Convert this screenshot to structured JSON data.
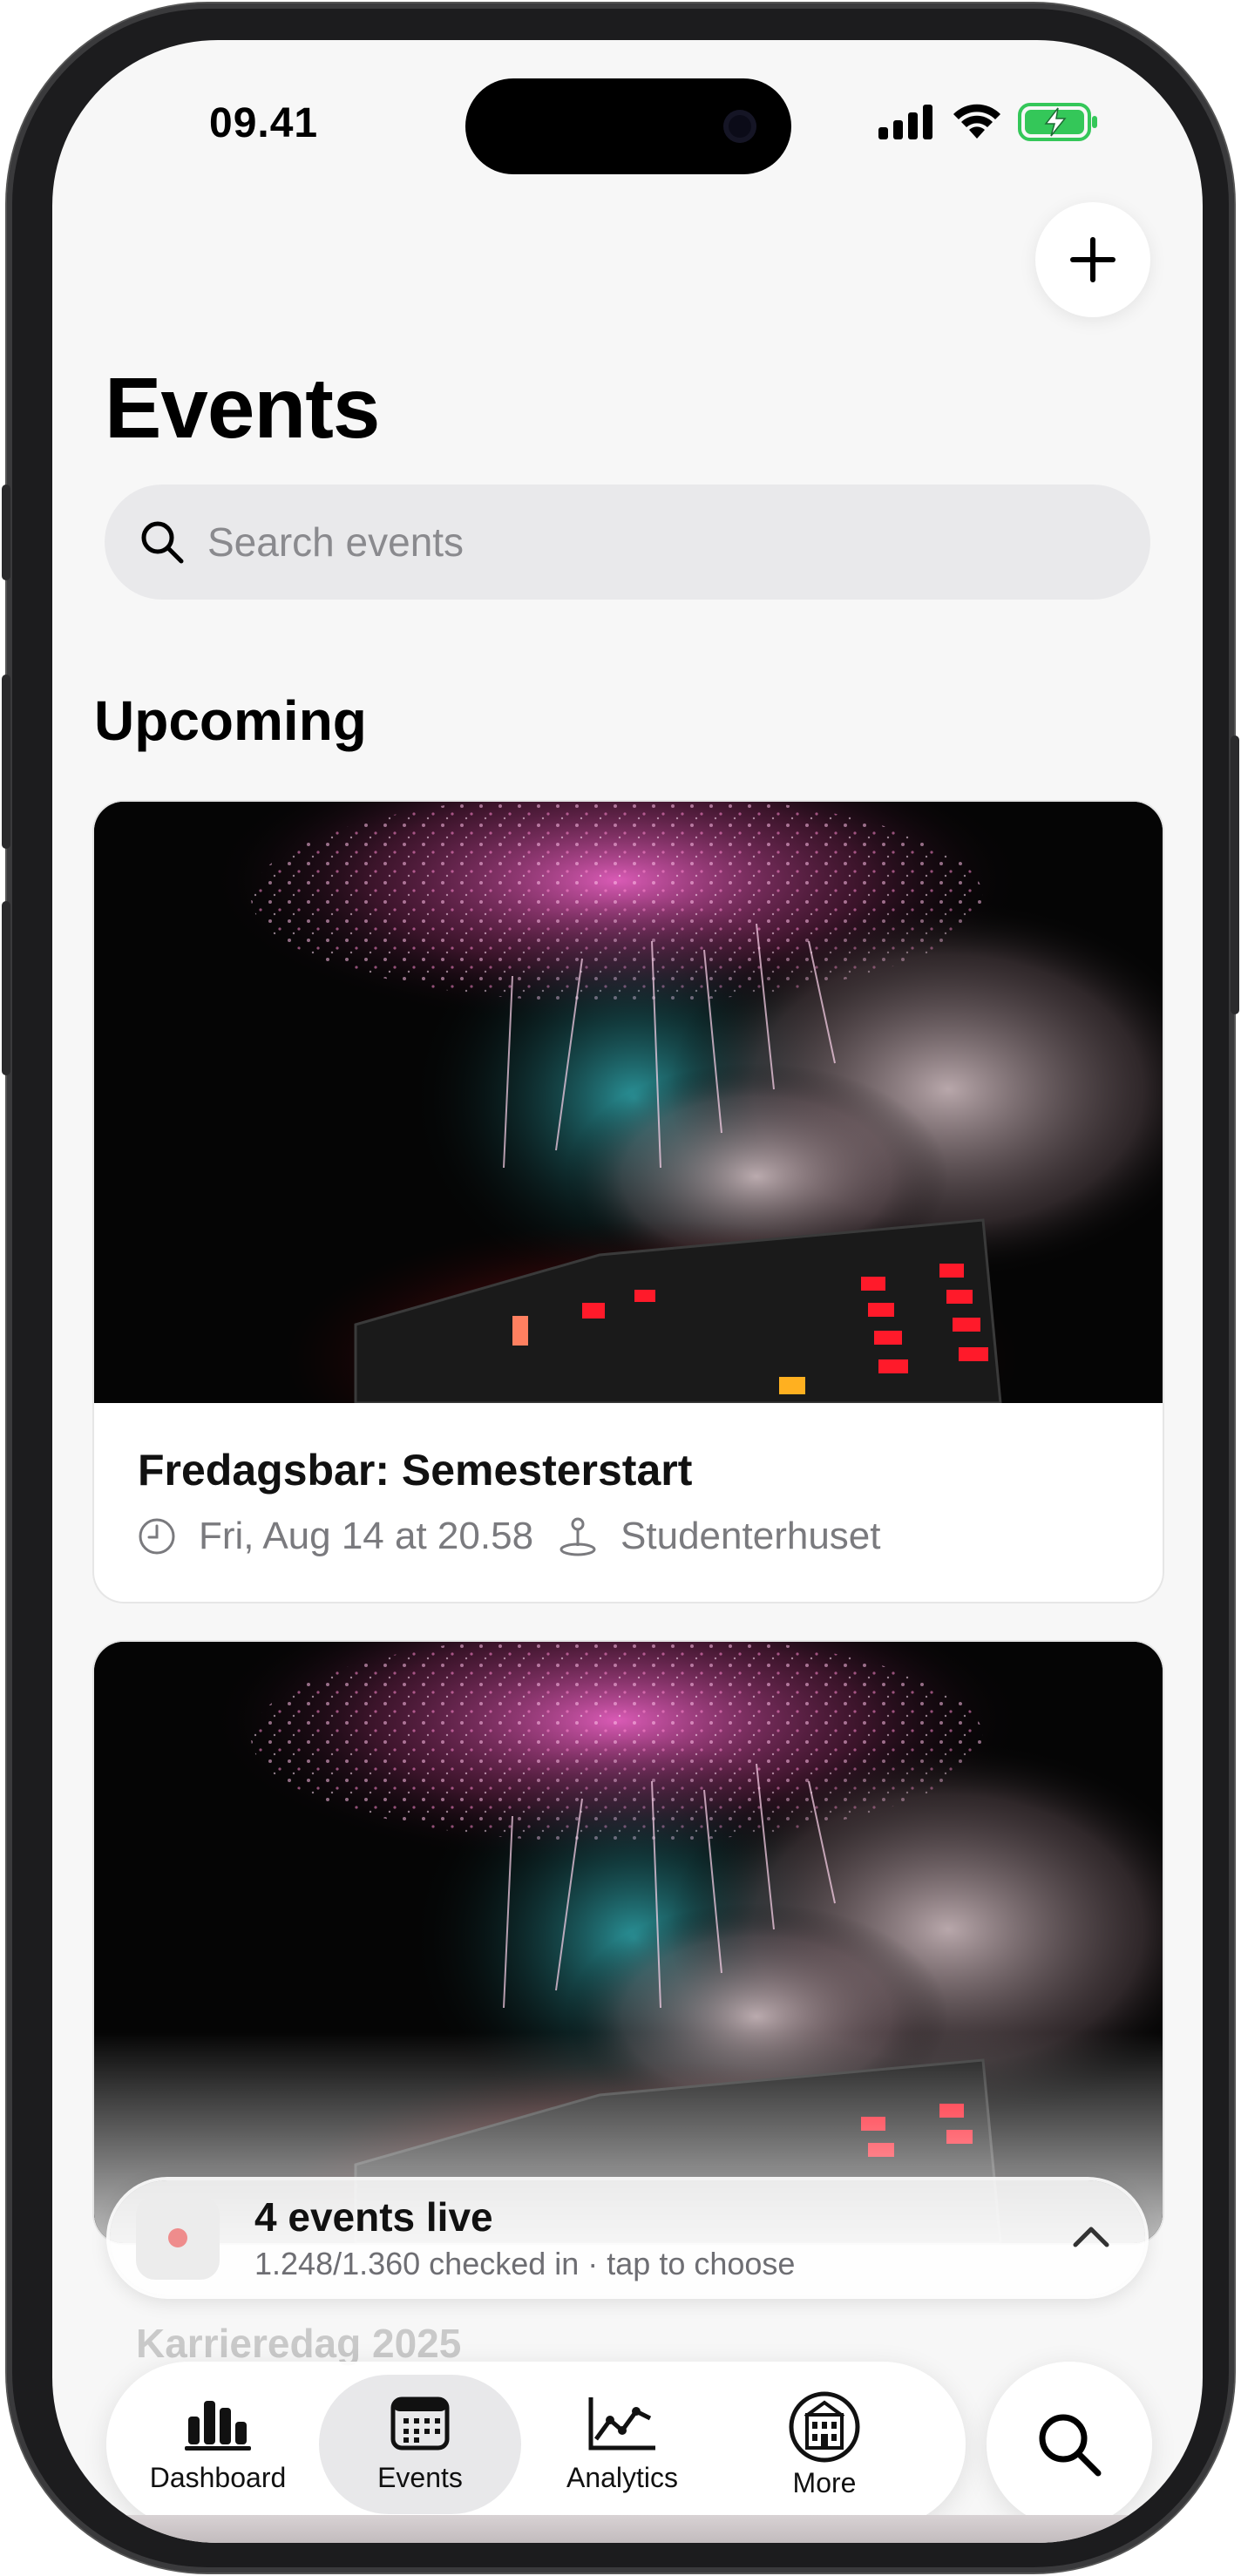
{
  "status_bar": {
    "time": "09.41"
  },
  "header": {
    "title": "Events",
    "add_label": "+"
  },
  "search": {
    "placeholder": "Search events",
    "value": ""
  },
  "sections": {
    "upcoming": "Upcoming"
  },
  "events": [
    {
      "name": "Fredagsbar: Semesterstart",
      "date": "Fri, Aug 14 at 20.58",
      "location": "Studenterhuset"
    },
    {
      "name": "Karrieredag 2025"
    }
  ],
  "live_banner": {
    "title": "4 events live",
    "subtitle": "1.248/1.360 checked in · tap to choose"
  },
  "tabbar": {
    "items": [
      {
        "label": "Dashboard",
        "icon": "bar-chart-icon"
      },
      {
        "label": "Events",
        "icon": "calendar-icon",
        "active": true
      },
      {
        "label": "Analytics",
        "icon": "line-chart-icon"
      },
      {
        "label": "More",
        "icon": "building-badge-icon"
      }
    ]
  },
  "colors": {
    "background": "#f7f7f7",
    "battery": "#34c759",
    "live_dot": "#ef8c8c"
  }
}
